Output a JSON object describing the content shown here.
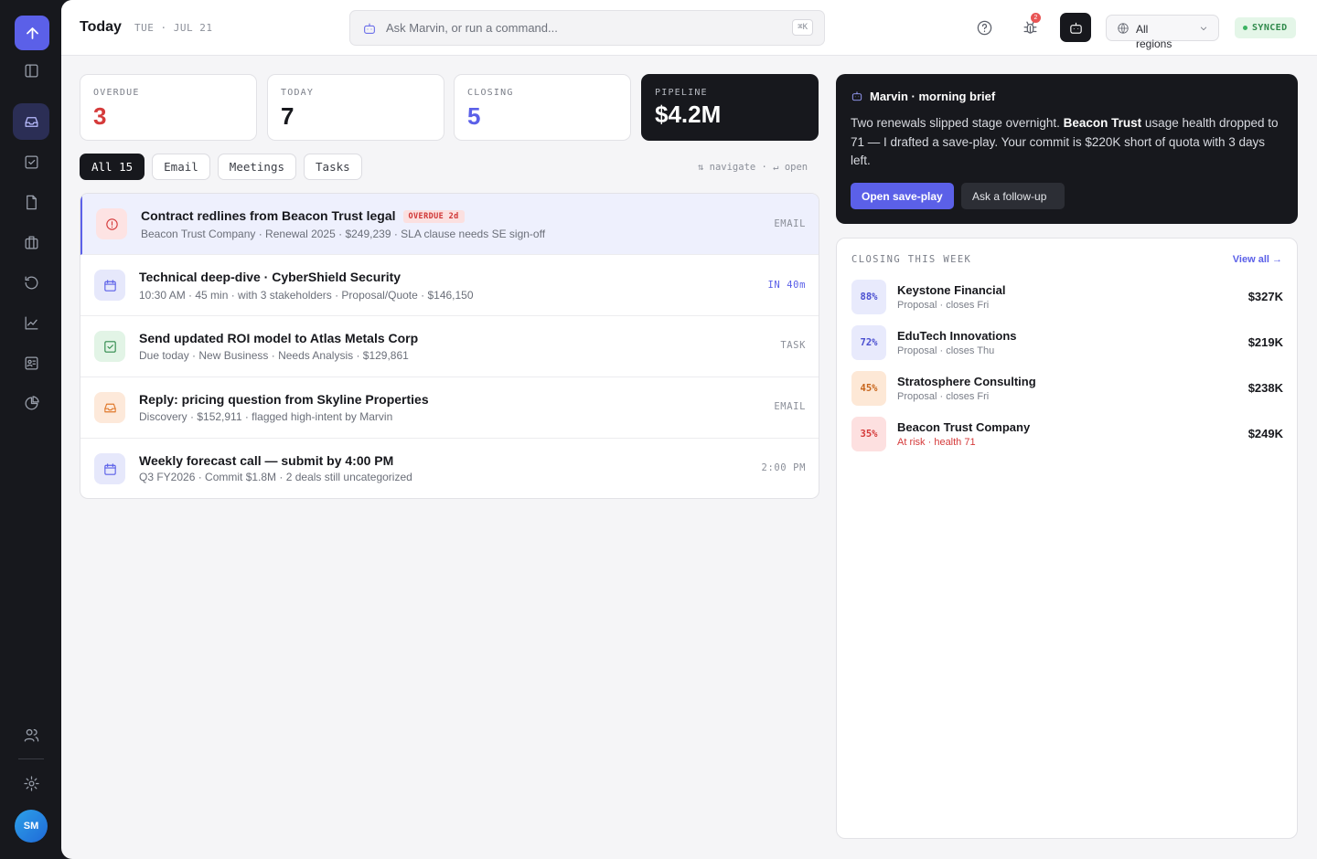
{
  "header": {
    "title": "Today",
    "date": "TUE · JUL 21",
    "search_placeholder": "Ask Marvin, or run a command...",
    "search_shortcut": "⌘K",
    "notif_count": "2",
    "region": "All regions",
    "sync": "SYNCED"
  },
  "user": {
    "initials": "SM"
  },
  "stats": [
    {
      "label": "OVERDUE",
      "value": "3",
      "color": "#d53a3a"
    },
    {
      "label": "TODAY",
      "value": "7",
      "color": "#17181d"
    },
    {
      "label": "CLOSING",
      "value": "5",
      "color": "#5b60e8"
    },
    {
      "label": "PIPELINE",
      "value": "$4.2M",
      "color": "#ffffff"
    }
  ],
  "tabs": [
    "All 15",
    "Email",
    "Meetings",
    "Tasks"
  ],
  "hint": "⇅ navigate · ↵ open",
  "items": [
    {
      "title": "Contract redlines from Beacon Trust legal",
      "badge": "OVERDUE 2d",
      "sub": "Beacon Trust Company · Renewal 2025 · $249,239 · SLA clause needs SE sign-off",
      "tag": "EMAIL",
      "icon": "alert-icon"
    },
    {
      "title": "Technical deep-dive · CyberShield Security",
      "sub": "10:30 AM · 45 min · with 3 stakeholders · Proposal/Quote · $146,150",
      "tag": "IN 40m",
      "icon": "calendar-icon"
    },
    {
      "title": "Send updated ROI model to Atlas Metals Corp",
      "sub": "Due today · New Business · Needs Analysis · $129,861",
      "tag": "TASK",
      "icon": "task-check-icon"
    },
    {
      "title": "Reply: pricing question from Skyline Properties",
      "sub": "Discovery · $152,911 · flagged high-intent by Marvin",
      "tag": "EMAIL",
      "icon": "inbox-icon"
    },
    {
      "title": "Weekly forecast call — submit by 4:00 PM",
      "sub": "Q3 FY2026 · Commit $1.8M · 2 deals still uncategorized",
      "tag": "2:00 PM",
      "icon": "calendar-icon"
    }
  ],
  "brief": {
    "title": "Marvin · morning brief",
    "text_a": "Two renewals slipped stage overnight. ",
    "text_b": "Beacon Trust",
    "text_c": " usage health dropped to 71 — I drafted a save-play. Your commit is $220K short of quota with 3 days left.",
    "primary": "Open save-play",
    "secondary": "Ask a follow-up"
  },
  "closing": {
    "title": "CLOSING THIS WEEK",
    "view_all": "View all →",
    "deals": [
      {
        "pct": "88%",
        "name": "Keystone Financial",
        "sub": "Proposal · closes Fri",
        "amount": "$327K"
      },
      {
        "pct": "72%",
        "name": "EduTech Innovations",
        "sub": "Proposal · closes Thu",
        "amount": "$219K"
      },
      {
        "pct": "45%",
        "name": "Stratosphere Consulting",
        "sub": "Proposal · closes Fri",
        "amount": "$238K"
      },
      {
        "pct": "35%",
        "name": "Beacon Trust Company",
        "sub": "At risk · health 71",
        "amount": "$249K"
      }
    ]
  },
  "colors": {
    "accent": "#5b60e8",
    "dark": "#17181d",
    "danger": "#d53a3a"
  }
}
